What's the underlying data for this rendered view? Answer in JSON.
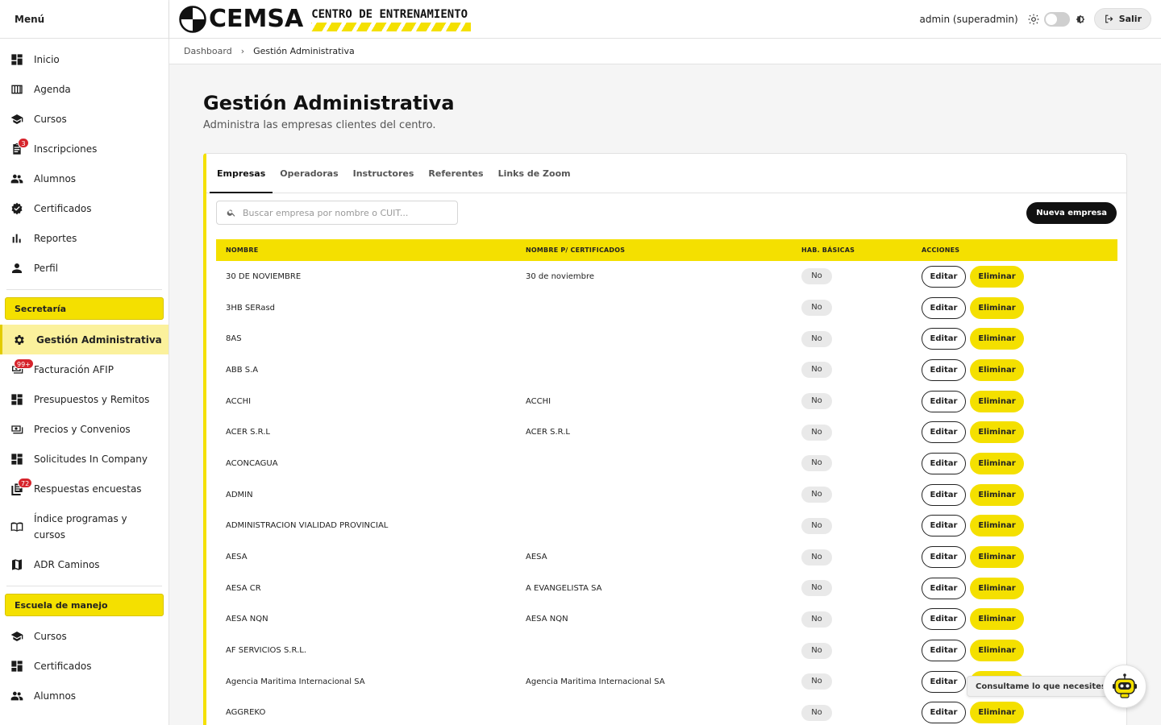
{
  "sidebar": {
    "title": "Menú",
    "main_items": [
      {
        "label": "Inicio",
        "icon": "dashboard-icon"
      },
      {
        "label": "Agenda",
        "icon": "calendar-icon"
      },
      {
        "label": "Cursos",
        "icon": "graduation-cap-icon"
      },
      {
        "label": "Inscripciones",
        "icon": "clipboard-icon",
        "badge": "3"
      },
      {
        "label": "Alumnos",
        "icon": "people-icon"
      },
      {
        "label": "Certificados",
        "icon": "verified-icon"
      },
      {
        "label": "Reportes",
        "icon": "bar-chart-icon"
      },
      {
        "label": "Perfil",
        "icon": "person-icon"
      }
    ],
    "section_secretaria": "Secretaría",
    "secretaria_items": [
      {
        "label": "Gestión Administrativa",
        "icon": "gear-icon",
        "active": true
      },
      {
        "label": "Facturación AFIP",
        "icon": "receipt-icon",
        "badge": "99+"
      },
      {
        "label": "Presupuestos y Remitos",
        "icon": "dashboard-icon"
      },
      {
        "label": "Precios y Convenios",
        "icon": "money-icon"
      },
      {
        "label": "Solicitudes In Company",
        "icon": "dashboard-icon"
      },
      {
        "label": "Respuestas encuestas",
        "icon": "library-icon",
        "badge": "72"
      },
      {
        "label": "Índice programas y cursos",
        "icon": "book-icon"
      },
      {
        "label": "ADR Caminos",
        "icon": "map-icon"
      }
    ],
    "section_escuela": "Escuela de manejo",
    "escuela_items": [
      {
        "label": "Cursos",
        "icon": "graduation-cap-icon"
      },
      {
        "label": "Certificados",
        "icon": "dashboard-icon"
      },
      {
        "label": "Alumnos",
        "icon": "people-icon"
      }
    ]
  },
  "topbar": {
    "brand": "CEMSA",
    "brand_sub": "CENTRO DE ENTRENAMIENTO",
    "user": "admin (superadmin)",
    "logout": "Salir"
  },
  "breadcrumb": {
    "root": "Dashboard",
    "current": "Gestión Administrativa"
  },
  "page": {
    "title": "Gestión Administrativa",
    "subtitle": "Administra las empresas clientes del centro."
  },
  "tabs": [
    "Empresas",
    "Operadoras",
    "Instructores",
    "Referentes",
    "Links de Zoom"
  ],
  "search": {
    "placeholder": "Buscar empresa por nombre o CUIT..."
  },
  "new_button": "Nueva empresa",
  "table": {
    "headers": [
      "NOMBRE",
      "NOMBRE P/ CERTIFICADOS",
      "HAB. BÁSICAS",
      "ACCIONES"
    ],
    "edit_label": "Editar",
    "delete_label": "Eliminar",
    "rows": [
      {
        "name": "30 DE NOVIEMBRE",
        "cert": "30 de noviembre",
        "hab": "No"
      },
      {
        "name": "3HB SERasd",
        "cert": "",
        "hab": "No"
      },
      {
        "name": "8AS",
        "cert": "",
        "hab": "No"
      },
      {
        "name": "ABB S.A",
        "cert": "",
        "hab": "No"
      },
      {
        "name": "ACCHI",
        "cert": "ACCHI",
        "hab": "No"
      },
      {
        "name": "ACER S.R.L",
        "cert": "ACER S.R.L",
        "hab": "No"
      },
      {
        "name": "ACONCAGUA",
        "cert": "",
        "hab": "No"
      },
      {
        "name": "ADMIN",
        "cert": "",
        "hab": "No"
      },
      {
        "name": "ADMINISTRACION VIALIDAD PROVINCIAL",
        "cert": "",
        "hab": "No"
      },
      {
        "name": "AESA",
        "cert": "AESA",
        "hab": "No"
      },
      {
        "name": "AESA CR",
        "cert": "A EVANGELISTA SA",
        "hab": "No"
      },
      {
        "name": "AESA NQN",
        "cert": "AESA NQN",
        "hab": "No"
      },
      {
        "name": "AF SERVICIOS S.R.L.",
        "cert": "",
        "hab": "No"
      },
      {
        "name": "Agencia Maritima Internacional SA",
        "cert": "Agencia Maritima Internacional SA",
        "hab": "No"
      },
      {
        "name": "AGGREKO",
        "cert": "",
        "hab": "No"
      }
    ]
  },
  "chat": {
    "tooltip": "Consultame lo que necesites"
  },
  "colors": {
    "accent": "#f4e000",
    "badge": "#d6242c",
    "dark": "#111111"
  }
}
